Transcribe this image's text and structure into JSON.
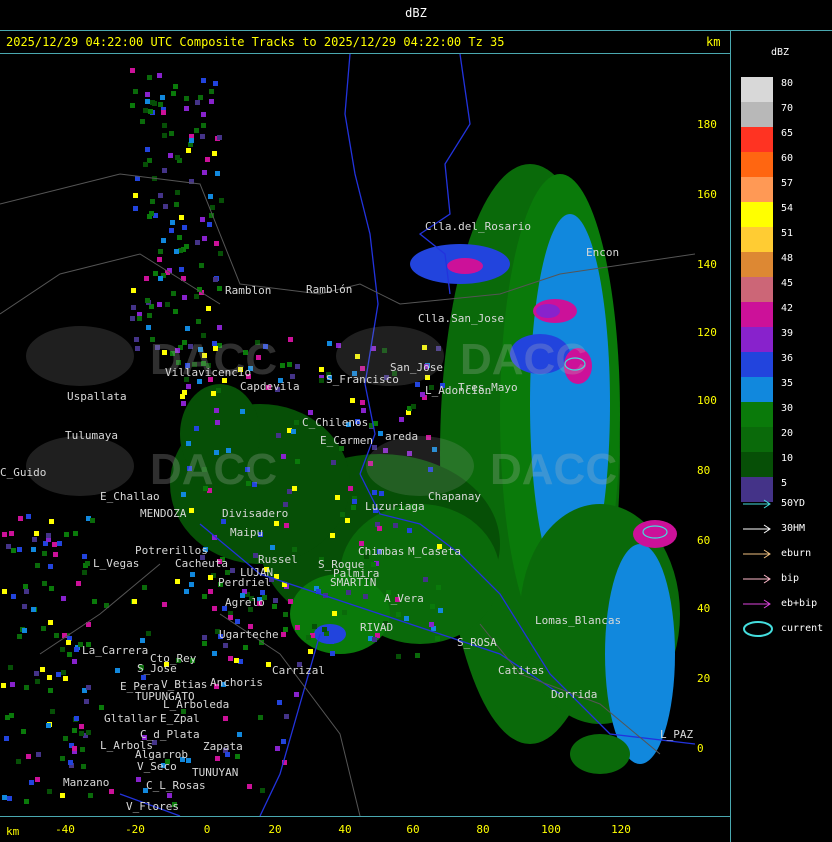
{
  "title_bar": {
    "text": "dBZ"
  },
  "header": {
    "text": "2025/12/29 04:22:00 UTC Composite Tracks to 2025/12/29 04:22:00 Tz 35",
    "unit": "km"
  },
  "y_axis": {
    "ticks": [
      "180",
      "160",
      "140",
      "120",
      "100",
      "80",
      "60",
      "40",
      "20",
      "0"
    ]
  },
  "x_axis": {
    "unit": "km",
    "ticks": [
      "-40",
      "-20",
      "0",
      "20",
      "40",
      "60",
      "80",
      "100",
      "120"
    ]
  },
  "scale": {
    "title": "dBZ",
    "levels": [
      {
        "label": "80",
        "color": "#d8d8d8"
      },
      {
        "label": "70",
        "color": "#b8b8b8"
      },
      {
        "label": "65",
        "color": "#ff3322"
      },
      {
        "label": "60",
        "color": "#ff6611"
      },
      {
        "label": "57",
        "color": "#ff9955"
      },
      {
        "label": "54",
        "color": "#ffff00"
      },
      {
        "label": "51",
        "color": "#ffcc33"
      },
      {
        "label": "48",
        "color": "#dd8833"
      },
      {
        "label": "45",
        "color": "#cc6677"
      },
      {
        "label": "42",
        "color": "#cc1199"
      },
      {
        "label": "39",
        "color": "#8822cc"
      },
      {
        "label": "36",
        "color": "#2244dd"
      },
      {
        "label": "35",
        "color": "#1188dd"
      },
      {
        "label": "30",
        "color": "#0a7a0a"
      },
      {
        "label": "20",
        "color": "#0a6a0a"
      },
      {
        "label": "10",
        "color": "#064f06"
      },
      {
        "label": "5",
        "color": "#443388"
      }
    ]
  },
  "legend": [
    {
      "label": "50YD",
      "color": "#44dddd"
    },
    {
      "label": "30HM",
      "color": "#ffffff"
    },
    {
      "label": "eburn",
      "color": "#f0c080"
    },
    {
      "label": "bip",
      "color": "#ffbbcc"
    },
    {
      "label": "eb+bip",
      "color": "#dd44dd"
    },
    {
      "label": "current",
      "color": "#44dddd"
    }
  ],
  "places": [
    {
      "name": "Clla.del_Rosario"
    },
    {
      "name": "Encon"
    },
    {
      "name": "Ramblón"
    },
    {
      "name": "Clla.San_Jose"
    },
    {
      "name": "Villavicencio"
    },
    {
      "name": "Capdevila"
    },
    {
      "name": "Uspallata"
    },
    {
      "name": "S_Francisco"
    },
    {
      "name": "San_Jose"
    },
    {
      "name": "Tres_Mayo"
    },
    {
      "name": "C_Chilenos"
    },
    {
      "name": "Tulumaya"
    },
    {
      "name": "E_Carmen"
    },
    {
      "name": "areda"
    },
    {
      "name": "C_Guido"
    },
    {
      "name": "E_Challao"
    },
    {
      "name": "MENDOZA"
    },
    {
      "name": "Divisadero"
    },
    {
      "name": "Chapanay"
    },
    {
      "name": "Luzuriaga"
    },
    {
      "name": "Maipu"
    },
    {
      "name": "Potrerillos"
    },
    {
      "name": "Cacheuta"
    },
    {
      "name": "L_Vegas"
    },
    {
      "name": "Russel"
    },
    {
      "name": "LUJAN"
    },
    {
      "name": "Perdriel"
    },
    {
      "name": "S_Roque"
    },
    {
      "name": "Palmira"
    },
    {
      "name": "Chimbas"
    },
    {
      "name": "M_Caseta"
    },
    {
      "name": "SMARTIN"
    },
    {
      "name": "A_Vera"
    },
    {
      "name": "Agrelo"
    },
    {
      "name": "RIVAD"
    },
    {
      "name": "Ugarteche"
    },
    {
      "name": "La_Carrera"
    },
    {
      "name": "Cto_Rey"
    },
    {
      "name": "S_Jose"
    },
    {
      "name": "Carrizal"
    },
    {
      "name": "Lomas_Blancas"
    },
    {
      "name": "S_ROSA"
    },
    {
      "name": "Catitas"
    },
    {
      "name": "E_Pera"
    },
    {
      "name": "TUPUNGATO"
    },
    {
      "name": "Anchoris"
    },
    {
      "name": "V_Btias"
    },
    {
      "name": "Dorrida"
    },
    {
      "name": "Gltallar"
    },
    {
      "name": "E_Zpal"
    },
    {
      "name": "L_Arboleda"
    },
    {
      "name": "L_Arbols"
    },
    {
      "name": "Zapata"
    },
    {
      "name": "C_d_Plata"
    },
    {
      "name": "L_PAZ"
    },
    {
      "name": "Algarrob"
    },
    {
      "name": "Manzano"
    },
    {
      "name": "TUNUYAN"
    },
    {
      "name": "V_Seco"
    },
    {
      "name": "C_L_Rosas"
    },
    {
      "name": "V_Flores"
    },
    {
      "name": "Ramblon"
    },
    {
      "name": "L_Adoncion"
    }
  ],
  "watermark": {
    "text": "DACC"
  }
}
